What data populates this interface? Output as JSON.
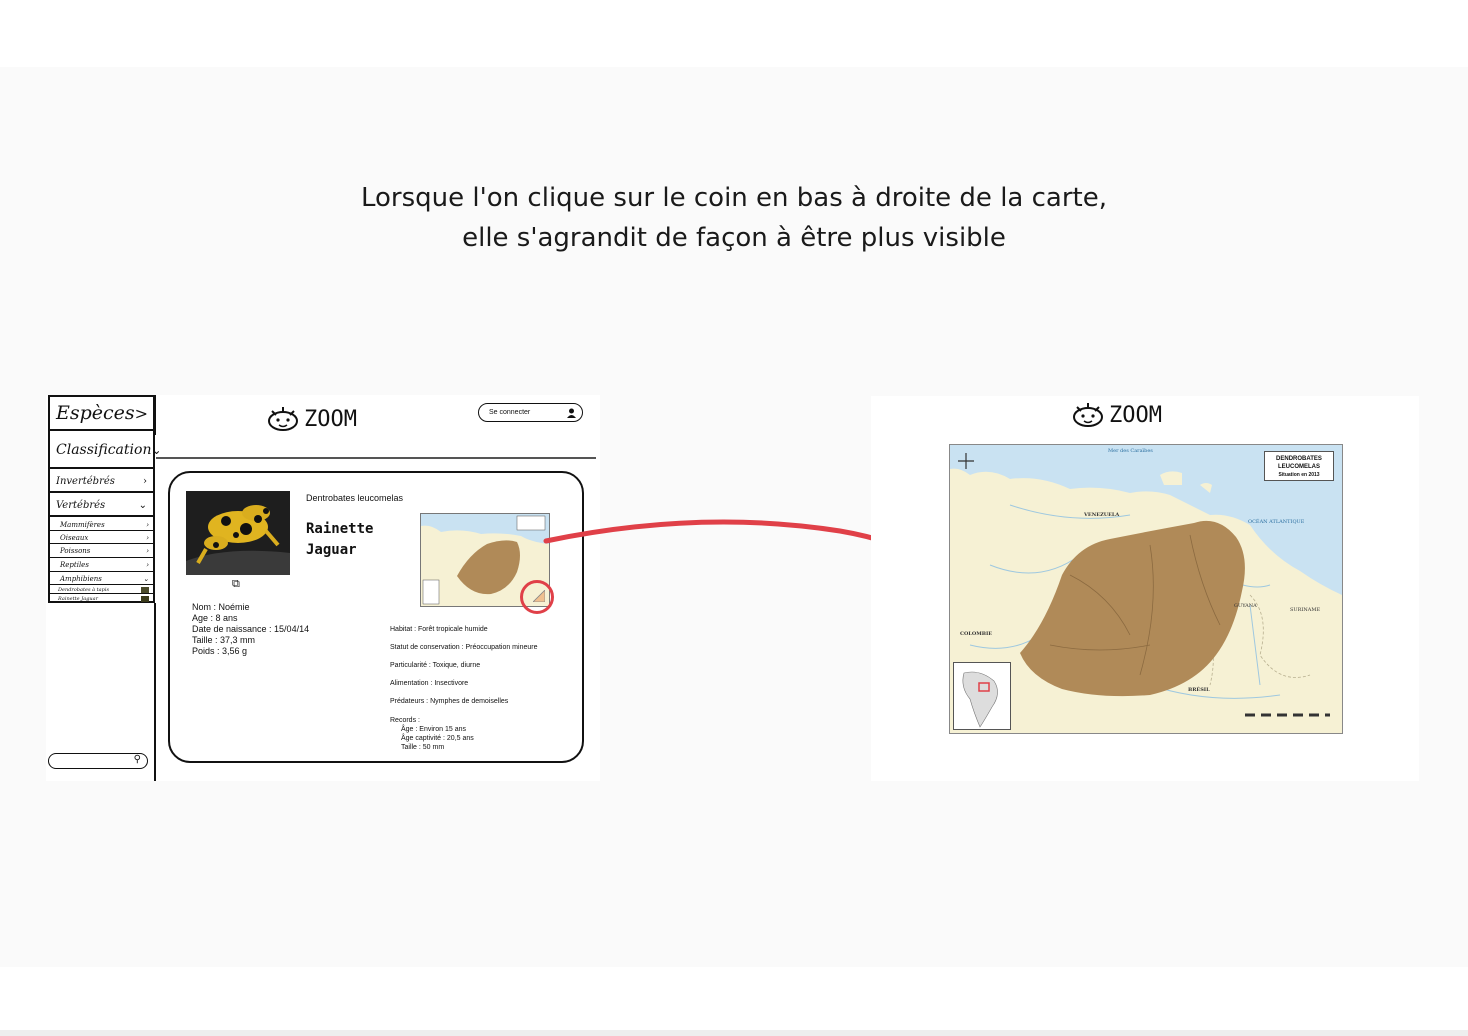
{
  "caption": {
    "line1": "Lorsque l'on clique sur le coin en bas à droite de la carte,",
    "line2": "elle s'agrandit de façon à être plus visible"
  },
  "left_mockup": {
    "sidebar": {
      "especes": "Espèces",
      "classification": "Classification",
      "items": [
        {
          "label": "Invertébrés",
          "icon": "chevron-right"
        },
        {
          "label": "Vertébrés",
          "icon": "chevron-down"
        }
      ],
      "subitems": [
        "Mammifères",
        "Oiseaux",
        "Poissons",
        "Reptiles",
        "Amphibiens"
      ],
      "leaves": [
        "Dendrobates à tapis",
        "Rainette Jaguar"
      ]
    },
    "logo_text": "ZOOM",
    "login_label": "Se connecter",
    "card": {
      "species_latin": "Dentrobates leucomelas",
      "species_name_line1": "Rainette",
      "species_name_line2": "Jaguar",
      "identity": [
        "Nom : Noémie",
        "Age : 8 ans",
        "Date de naissance : 15/04/14",
        "Taille : 37,3 mm",
        "Poids : 3,56 g"
      ],
      "info": [
        "Habitat : Forêt tropicale humide",
        "Statut de conservation : Préoccupation mineure",
        "Particularité : Toxique, diurne",
        "Alimentation : Insectivore",
        "Prédateurs : Nymphes de demoiselles"
      ],
      "records_title": "Records :",
      "records": [
        "Âge : Environ 15 ans",
        "Âge captivité : 20,5 ans",
        "Taille : 50 mm"
      ]
    }
  },
  "right_mockup": {
    "logo_text": "ZOOM",
    "map": {
      "legend_line1": "DENDROBATES",
      "legend_line2": "LEUCOMELAS",
      "legend_line3": "Situation en 2013",
      "labels": {
        "sea_caribbean": "Mer des Caraïbes",
        "venezuela": "VENEZUELA",
        "ocean": "OCÉAN ATLANTIQUE",
        "colombie": "COLOMBIE",
        "bresil": "BRÉSIL",
        "guyana": "GUYANA",
        "suriname": "SURINAME"
      }
    }
  },
  "colors": {
    "range_fill": "#b08a58",
    "sea": "#c9e2f2",
    "land": "#f6f1d4",
    "highlight": "#e04048"
  }
}
